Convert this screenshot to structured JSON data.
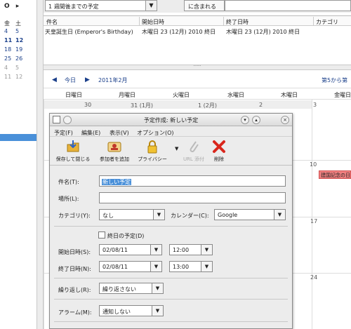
{
  "mini_calendar": {
    "nav": [
      "O",
      "▸"
    ],
    "rows": [
      [
        "金",
        "土"
      ],
      [
        "4",
        "5"
      ],
      [
        "11",
        "12"
      ],
      [
        "18",
        "19"
      ],
      [
        "25",
        "26"
      ],
      [
        "4",
        "5"
      ],
      [
        "11",
        "12"
      ]
    ]
  },
  "search": {
    "filter_value": "1 週間後までの予定",
    "field_label": "に含まれる",
    "query": ""
  },
  "results": {
    "columns": [
      "件名",
      "開始日時",
      "終了日時",
      "カテゴリ"
    ],
    "rows": [
      {
        "title": "天皇誕生日 (Emperor's Birthday)",
        "start": "木曜日 23 (12月) 2010 終日",
        "end": "木曜日 23 (12月) 2010 終日",
        "category": ""
      }
    ]
  },
  "month_view": {
    "today_label": "今日",
    "month_label": "2011年2月",
    "week_label": "第5から第",
    "weekdays": [
      "日曜日",
      "月曜日",
      "火曜日",
      "水曜日",
      "木曜日",
      "金曜日"
    ],
    "first_row": [
      "30",
      "31 (1月)",
      "1 (2月)",
      "2",
      "3"
    ],
    "visible_days": [
      "10",
      "17",
      "24"
    ],
    "event": "建国記念の日"
  },
  "dialog": {
    "title": "予定作成: 新しい予定",
    "menus": [
      "予定(F)",
      "編集(E)",
      "表示(V)",
      "オプション(O)"
    ],
    "toolbar": [
      {
        "label": "保存して閉じる",
        "icon": "save-close-icon"
      },
      {
        "label": "参加者を追加",
        "icon": "add-attendee-icon"
      },
      {
        "label": "プライバシー",
        "icon": "privacy-lock-icon"
      },
      {
        "label": "URL 添付",
        "icon": "attach-icon"
      },
      {
        "label": "削除",
        "icon": "delete-icon"
      }
    ],
    "title_label": "件名(T):",
    "title_value": "新しい予定",
    "location_label": "場所(L):",
    "location_value": "",
    "category_label": "カテゴリ(Y):",
    "category_value": "なし",
    "calendar_label": "カレンダー(C):",
    "calendar_value": "Google",
    "allday_label": "終日の予定(D)",
    "start_label": "開始日時(S):",
    "start_date": "02/08/11",
    "start_time": "12:00",
    "end_label": "終了日時(N):",
    "end_date": "02/08/11",
    "end_time": "13:00",
    "repeat_label": "繰り返し(R):",
    "repeat_value": "繰り返さない",
    "alarm_label": "アラーム(M):",
    "alarm_value": "通知しない"
  },
  "colors": {
    "selection": "#4a90d9",
    "event": "#f08080"
  }
}
